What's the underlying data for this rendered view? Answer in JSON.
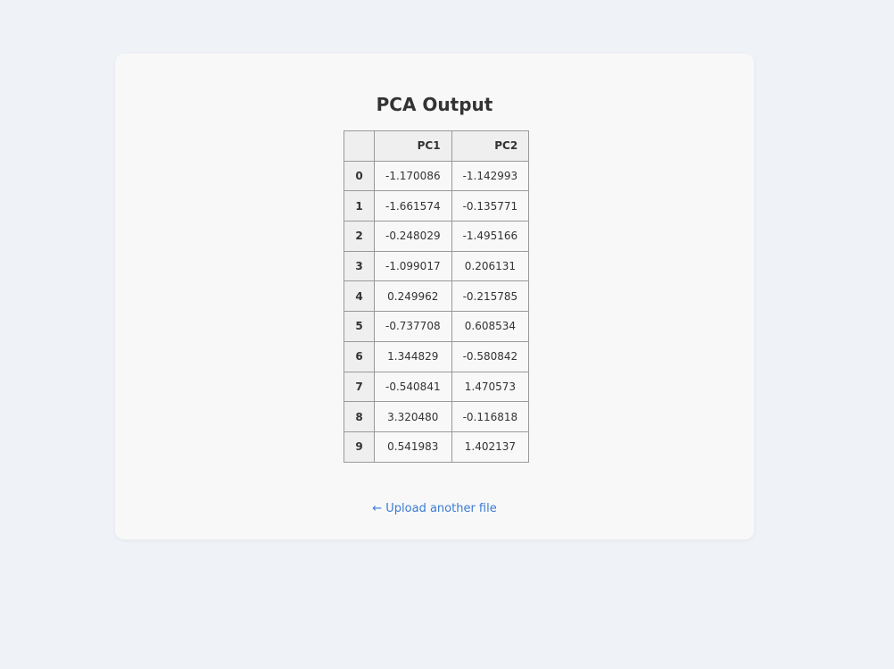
{
  "page": {
    "title": "PCA Output",
    "back_link": "← Upload another file"
  },
  "table": {
    "columns": [
      "PC1",
      "PC2"
    ],
    "rows": [
      {
        "index": "0",
        "pc1": "-1.170086",
        "pc2": "-1.142993"
      },
      {
        "index": "1",
        "pc1": "-1.661574",
        "pc2": "-0.135771"
      },
      {
        "index": "2",
        "pc1": "-0.248029",
        "pc2": "-1.495166"
      },
      {
        "index": "3",
        "pc1": "-1.099017",
        "pc2": "0.206131"
      },
      {
        "index": "4",
        "pc1": "0.249962",
        "pc2": "-0.215785"
      },
      {
        "index": "5",
        "pc1": "-0.737708",
        "pc2": "0.608534"
      },
      {
        "index": "6",
        "pc1": "1.344829",
        "pc2": "-0.580842"
      },
      {
        "index": "7",
        "pc1": "-0.540841",
        "pc2": "1.470573"
      },
      {
        "index": "8",
        "pc1": "3.320480",
        "pc2": "-0.116818"
      },
      {
        "index": "9",
        "pc1": "0.541983",
        "pc2": "1.402137"
      }
    ]
  },
  "colors": {
    "background": "#eff2f7",
    "card": "#f8f8f8",
    "link": "#3a7bd5",
    "header_bg": "#efefef",
    "border": "#999999"
  }
}
